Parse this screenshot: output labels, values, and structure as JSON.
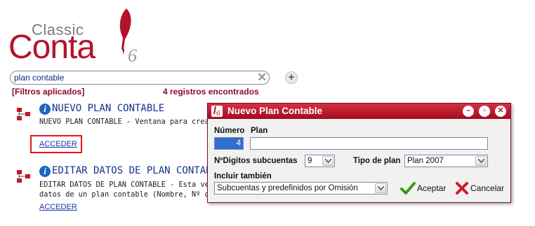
{
  "logo": {
    "word_top": "Classic",
    "word_main": "Conta",
    "mark": "6"
  },
  "search": {
    "value": "plan contable",
    "clear_icon": "clear-x-icon",
    "add_icon": "plus-icon"
  },
  "filters_label": "[Filtros aplicados]",
  "results_count": "4 registros encontrados",
  "results": [
    {
      "title": "NUEVO PLAN CONTABLE",
      "desc_line1": "NUEVO PLAN CONTABLE - Ventana para crea",
      "link": "ACCEDER"
    },
    {
      "title": "EDITAR DATOS DE PLAN CONTAB",
      "desc_line1": "EDITAR DATOS DE PLAN CONTABLE - Esta ve",
      "desc_line2": "datos de un plan contable (Nombre, Nº d",
      "link": "ACCEDER"
    }
  ],
  "dialog": {
    "title": "Nuevo Plan Contable",
    "app_icon_text": "6",
    "numero_label": "Número",
    "numero_value": "4",
    "plan_label": "Plan",
    "plan_value": "",
    "digitos_label": "NºDigitos subcuentas",
    "digitos_value": "9",
    "tipo_label": "Tipo de plan",
    "tipo_value": "Plan 2007",
    "incluir_label": "Incluir también",
    "incluir_value": "Subcuentas y predefinidos por Omisión",
    "accept_label": "Aceptar",
    "cancel_label": "Cancelar"
  },
  "colors": {
    "brand": "#b5122b",
    "link": "#1834a8",
    "highlight": "#e0141e"
  }
}
